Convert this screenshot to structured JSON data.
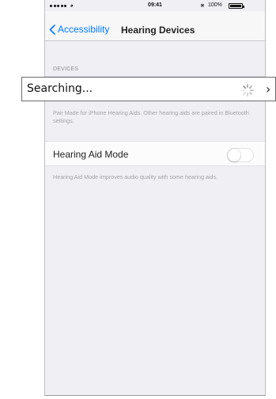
{
  "status_bar": {
    "time": "09:41",
    "battery_percent": "100%",
    "wifi_icon": "wifi-icon",
    "bluetooth_icon": "bluetooth-icon"
  },
  "nav": {
    "back_label": "Accessibility",
    "title": "Hearing Devices",
    "accent_color": "#007aff"
  },
  "devices": {
    "section_header": "DEVICES",
    "footer": "Pair Made for iPhone Hearing Aids. Other hearing aids are paired in Bluetooth settings."
  },
  "hearing_aid_mode": {
    "label": "Hearing Aid Mode",
    "enabled": false,
    "footer": "Hearing Aid Mode improves audio quality with some hearing aids."
  },
  "search_overlay": {
    "label": "Searching...",
    "spinner_icon": "spinner-icon",
    "chevron_icon": "chevron-right-icon"
  }
}
